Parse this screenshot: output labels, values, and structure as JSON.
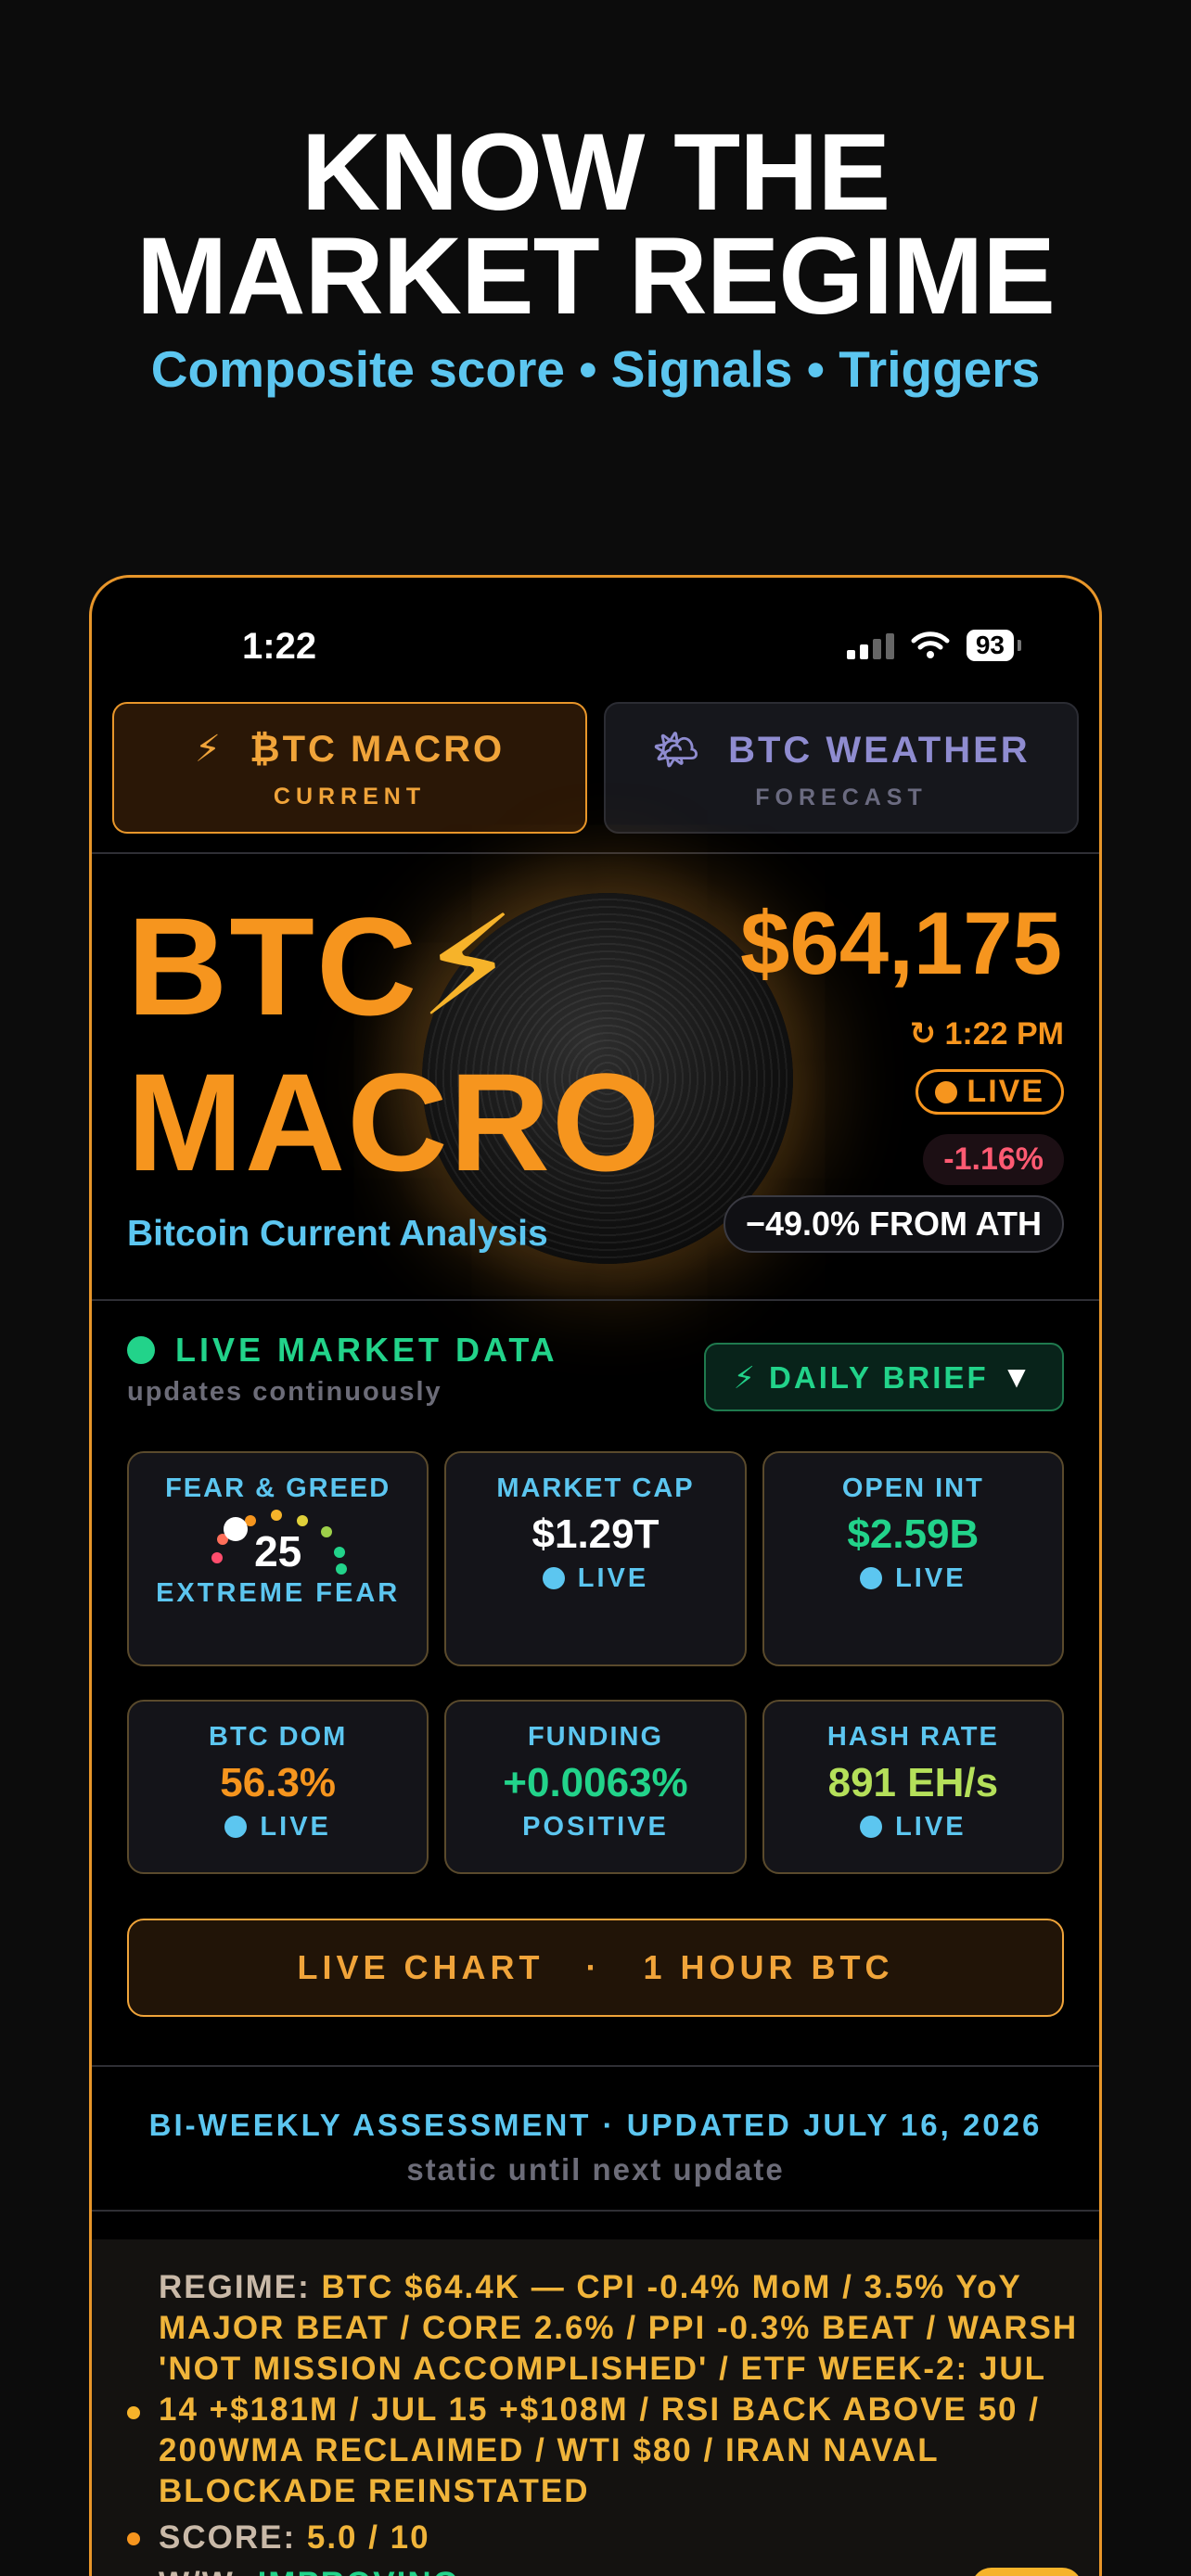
{
  "hero": {
    "title_line1": "KNOW THE",
    "title_line2": "MARKET REGIME",
    "subtitle": "Composite score • Signals • Triggers"
  },
  "status_bar": {
    "time": "1:22",
    "battery": "93"
  },
  "tabs": [
    {
      "icon": "⚡",
      "label": "₿TC MACRO",
      "sub": "CURRENT",
      "active": true
    },
    {
      "icon": "🌤",
      "label": "BTC WEATHER",
      "sub": "FORECAST",
      "active": false
    }
  ],
  "header": {
    "title_line1": "BTC",
    "bolt": "⚡",
    "title_line2": "MACRO",
    "analysis": "Bitcoin Current Analysis",
    "price": "$64,175",
    "time": "↻ 1:22 PM",
    "live": "LIVE",
    "change": "-1.16%",
    "from_ath": "−49.0% FROM ATH"
  },
  "live_market": {
    "title": "LIVE MARKET DATA",
    "subtitle": "updates continuously",
    "brief_button": "⚡ DAILY BRIEF",
    "brief_caret": "▼"
  },
  "cards": {
    "fear_greed": {
      "label": "FEAR & GREED",
      "value": "25",
      "status": "EXTREME FEAR",
      "score": 0.25
    },
    "market_cap": {
      "label": "MARKET CAP",
      "value": "$1.29T",
      "status": "LIVE",
      "color": "#ffffff"
    },
    "open_int": {
      "label": "OPEN INT",
      "value": "$2.59B",
      "status": "LIVE",
      "color": "#22d38a"
    },
    "btc_dom": {
      "label": "BTC DOM",
      "value": "56.3%",
      "status": "LIVE",
      "color": "#f6951e"
    },
    "funding": {
      "label": "FUNDING",
      "value": "+0.0063%",
      "status": "POSITIVE",
      "color": "#22d38a"
    },
    "hash_rate": {
      "label": "HASH RATE",
      "value": "891 EH/s",
      "status": "LIVE",
      "color": "#b5e05a"
    }
  },
  "chart_button": {
    "label": "LIVE CHART   ·   1 HOUR BTC"
  },
  "assessment": {
    "title": "BI-WEEKLY ASSESSMENT · UPDATED JULY 16, 2026",
    "subtitle": "static until next update"
  },
  "regime": {
    "label": "REGIME:",
    "text": "BTC $64.4K — CPI -0.4% MoM / 3.5% YoY MAJOR BEAT / CORE 2.6% / PPI -0.3% BEAT / WARSH 'NOT MISSION ACCOMPLISHED' / ETF WEEK-2: JUL 14 +$181M / JUL 15 +$108M / RSI BACK ABOVE 50 / 200WMA RECLAIMED / WTI $80 / IRAN NAVAL BLOCKADE REINSTATED",
    "score_label": "SCORE:",
    "score_value": "5.0 / 10",
    "wow_label": "W/W:",
    "wow_value": "IMPROVING"
  },
  "ai_badge": "AI",
  "colors": {
    "accent": "#f6951e",
    "cyan": "#5cc6f0",
    "green": "#22d38a",
    "red": "#ff5a72"
  }
}
